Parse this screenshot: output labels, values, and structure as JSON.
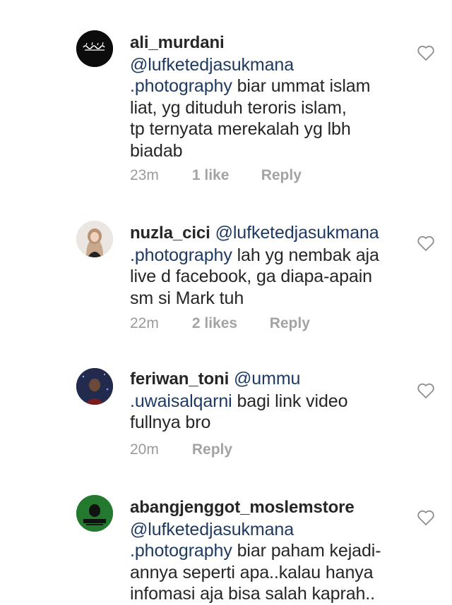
{
  "comments": [
    {
      "username": "ali_murdani",
      "lines": [
        {
          "mention": "@lufketedjasukmana",
          "text": ""
        },
        {
          "mention": ".photography",
          "text": " biar ummat islam"
        },
        {
          "mention": "",
          "text": "liat, yg dituduh teroris islam,"
        },
        {
          "mention": "",
          "text": "tp ternyata merekalah yg lbh"
        },
        {
          "mention": "",
          "text": "biadab"
        }
      ],
      "time": "23m",
      "likes": "1 like",
      "reply": "Reply"
    },
    {
      "username": "nuzla_cici",
      "lines": [
        {
          "mention": "@lufketedjasukmana",
          "text": ""
        },
        {
          "mention": ".photography",
          "text": " lah yg nembak aja"
        },
        {
          "mention": "",
          "text": "live d facebook, ga diapa-apain"
        },
        {
          "mention": "",
          "text": "sm si Mark tuh"
        }
      ],
      "time": "22m",
      "likes": "2 likes",
      "reply": "Reply"
    },
    {
      "username": "feriwan_toni",
      "lines": [
        {
          "mention": "@ummu",
          "text": ""
        },
        {
          "mention": ".uwaisalqarni",
          "text": " bagi link video"
        },
        {
          "mention": "",
          "text": "fullnya bro"
        }
      ],
      "time": "20m",
      "likes": "",
      "reply": "Reply"
    },
    {
      "username": "abangjenggot_moslemstore",
      "lines": [
        {
          "mention": "@lufketedjasukmana",
          "text": ""
        },
        {
          "mention": ".photography",
          "text": " biar paham kejadi-"
        },
        {
          "mention": "",
          "text": "annya seperti apa..kalau hanya"
        },
        {
          "mention": "",
          "text": "infomasi aja bisa salah kaprah.."
        }
      ],
      "time": "",
      "likes": "",
      "reply": ""
    }
  ],
  "icons": {
    "like": "heart-outline-icon"
  },
  "colors": {
    "mention": "#1e3a63",
    "meta": "#9a9a9a",
    "text": "#262626"
  }
}
